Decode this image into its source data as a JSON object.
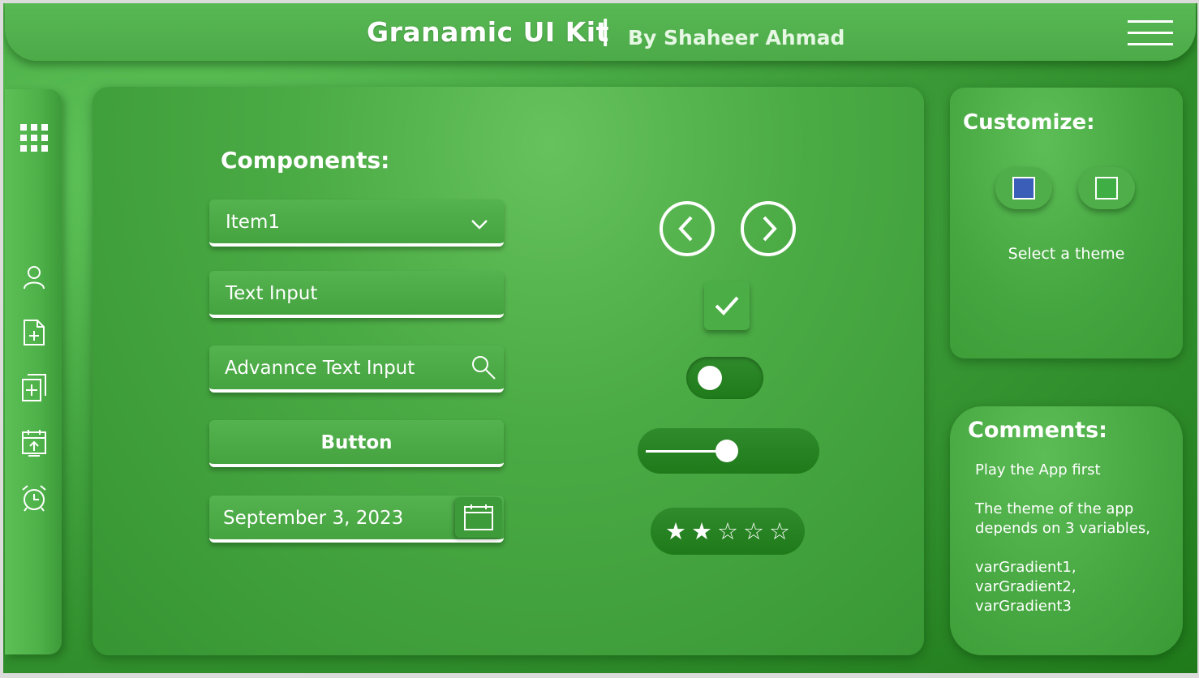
{
  "header": {
    "title": "Granamic UI Kit",
    "separator": "|",
    "subtitle": "By Shaheer Ahmad",
    "menu_icon": "hamburger-menu-icon"
  },
  "sidebar": {
    "items": [
      {
        "icon": "apps-grid-icon"
      },
      {
        "icon": "user-icon"
      },
      {
        "icon": "add-document-icon"
      },
      {
        "icon": "add-copy-icon"
      },
      {
        "icon": "calendar-upload-icon"
      },
      {
        "icon": "alarm-clock-icon"
      }
    ]
  },
  "components": {
    "title": "Components:",
    "dropdown": {
      "value": "Item1",
      "icon": "chevron-down-icon"
    },
    "text_input": {
      "value": "Text Input"
    },
    "advanced_input": {
      "value": "Advannce Text Input",
      "icon": "search-icon"
    },
    "button": {
      "label": "Button"
    },
    "date_picker": {
      "value": "September 3, 2023",
      "icon": "calendar-icon"
    },
    "nav": {
      "prev_icon": "chevron-left-circle-icon",
      "next_icon": "chevron-right-circle-icon"
    },
    "checkbox": {
      "checked": true
    },
    "toggle": {
      "on": false
    },
    "slider": {
      "value": 0.5
    },
    "rating": {
      "value": 2,
      "max": 5,
      "filled_char": "★",
      "empty_char": "☆"
    }
  },
  "customize": {
    "title": "Customize:",
    "themes": [
      {
        "name": "blue",
        "color": "#3b5fb8"
      },
      {
        "name": "green",
        "color": "#3fae44"
      }
    ],
    "select_label": "Select a theme"
  },
  "comments": {
    "title": "Comments:",
    "lines": [
      "Play the App first",
      "The theme of the app",
      "depends on 3 variables,",
      "varGradient1,",
      "varGradient2,",
      "varGradient3"
    ]
  },
  "colors": {
    "primary": "#4cab48",
    "dark": "#1f7a1a",
    "text": "#ffffff"
  }
}
